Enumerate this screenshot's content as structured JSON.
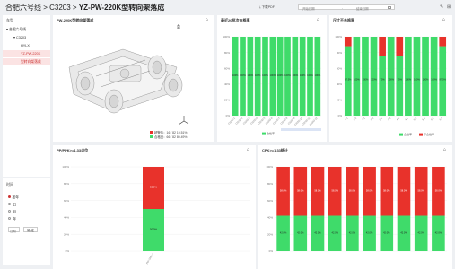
{
  "header": {
    "title_prefix": "合肥六号线 > C3203 > ",
    "title_main": "YZ-PW-220K型转向架落成",
    "download_label": "下载PDF",
    "start_placeholder": "开始日期",
    "end_placeholder": "结束日期",
    "separator": "-"
  },
  "sidebar": {
    "tree_title": "车型",
    "tree": [
      {
        "label": "合肥六号线",
        "level": 0,
        "arrow": "▾"
      },
      {
        "label": "C3203",
        "level": 1,
        "arrow": "▾"
      },
      {
        "label": "HYLX",
        "level": 2,
        "arrow": ""
      },
      {
        "label": "YZ-PW-220K",
        "level": 2,
        "arrow": "",
        "selected": true
      },
      {
        "label": "型转向架落成",
        "level": 2,
        "arrow": "",
        "selected": true
      }
    ],
    "time_title": "时间",
    "time_options": [
      {
        "label": "日",
        "checked": false
      },
      {
        "label": "月",
        "checked": false
      },
      {
        "label": "年",
        "checked": false
      }
    ],
    "time_selected": "按年",
    "range_start_placeholder": "日期",
    "range_separator": "-",
    "range_confirm": "确 定"
  },
  "card1": {
    "title": "PW-220K型转向架落成",
    "legend": [
      {
        "label": "超警告：16 / 82 19.51%",
        "color": "#e8322b"
      },
      {
        "label": "合格品：66 / 82 80.49%",
        "color": "#3fdb6a"
      }
    ]
  },
  "card2": {
    "title": "最近20批次合格率",
    "legend": "合格率",
    "chart_data": {
      "type": "bar",
      "categories": [
        "C3203-1",
        "C3203-2",
        "C3203-3",
        "C3203-4",
        "C3203-5",
        "C3203-6",
        "C3203-7",
        "C3203-8",
        "C3203-9",
        "C3203-10",
        "C3203-11",
        "C3203-12"
      ],
      "values": [
        100,
        100,
        100,
        100,
        100,
        100,
        100,
        100,
        100,
        100,
        100,
        100
      ],
      "labels": [
        "100%",
        "100%",
        "100%",
        "100%",
        "100%",
        "100%",
        "100%",
        "100%",
        "100%",
        "100%",
        "100%",
        "100%"
      ],
      "yticks": [
        "100%",
        "80%",
        "60%",
        "40%",
        "20%",
        "0%"
      ],
      "ylim": [
        0,
        100
      ],
      "series_color": "#3fdb6a"
    }
  },
  "card3": {
    "title": "尺寸不合格率",
    "legend": [
      {
        "label": "合格率",
        "color": "#3fdb6a"
      },
      {
        "label": "不合格率",
        "color": "#e8322b"
      }
    ],
    "chart_data": {
      "type": "bar",
      "categories": [
        "1-1",
        "1-2",
        "2-1",
        "2-2",
        "3-1",
        "3-2",
        "4-1",
        "4-2",
        "5-1",
        "5-2",
        "6-1",
        "6-2"
      ],
      "series": [
        {
          "name": "合格率",
          "values": [
            88,
            100,
            100,
            100,
            75,
            100,
            75,
            100,
            100,
            100,
            100,
            88
          ],
          "color": "#3fdb6a"
        },
        {
          "name": "不合格率",
          "values": [
            12,
            0,
            0,
            0,
            25,
            0,
            25,
            0,
            0,
            0,
            0,
            12
          ],
          "color": "#e8322b"
        }
      ],
      "labels": [
        "87.5%",
        "100%",
        "100%",
        "100%",
        "75%",
        "100%",
        "75%",
        "100%",
        "100%",
        "100%",
        "100%",
        "87.5%"
      ],
      "yticks": [
        "100%",
        "80%",
        "60%",
        "40%",
        "20%",
        "0%"
      ],
      "ylim": [
        0,
        100
      ]
    }
  },
  "card4": {
    "title": "PP/PPK>=1.33点位",
    "chart_data": {
      "type": "bar",
      "categories": [
        "PW-220K-1"
      ],
      "series": [
        {
          "name": "合格",
          "values": [
            50
          ],
          "color": "#3fdb6a"
        },
        {
          "name": "不合格",
          "values": [
            50
          ],
          "color": "#e8322b"
        }
      ],
      "labels": [
        "50.0%",
        "50.0%"
      ],
      "yticks": [
        "100%",
        "80%",
        "60%",
        "40%",
        "20%",
        "0%"
      ],
      "ylim": [
        0,
        100
      ]
    }
  },
  "card5": {
    "title": "CPK>=1.33统计",
    "chart_data": {
      "type": "bar",
      "categories": [
        "C1",
        "C2",
        "C3",
        "C4",
        "C5",
        "C6",
        "C7",
        "C8",
        "C9",
        "C10"
      ],
      "series": [
        {
          "name": "合格",
          "values": [
            42,
            42,
            42,
            42,
            42,
            42,
            42,
            42,
            42,
            42
          ],
          "color": "#3fdb6a"
        },
        {
          "name": "不合格",
          "values": [
            58,
            58,
            58,
            58,
            58,
            58,
            58,
            58,
            58,
            58
          ],
          "color": "#e8322b"
        }
      ],
      "labels_low": [
        "42.0%",
        "42.0%",
        "42.0%",
        "42.0%",
        "42.0%",
        "42.0%",
        "42.0%",
        "42.0%",
        "42.0%",
        "42.0%"
      ],
      "labels_high": [
        "58.0%",
        "58.0%",
        "58.0%",
        "58.0%",
        "58.0%",
        "58.0%",
        "58.0%",
        "58.0%",
        "58.0%",
        "58.0%"
      ],
      "yticks": [
        "100%",
        "80%",
        "60%",
        "40%",
        "20%",
        "0%"
      ],
      "ylim": [
        0,
        100
      ]
    }
  }
}
